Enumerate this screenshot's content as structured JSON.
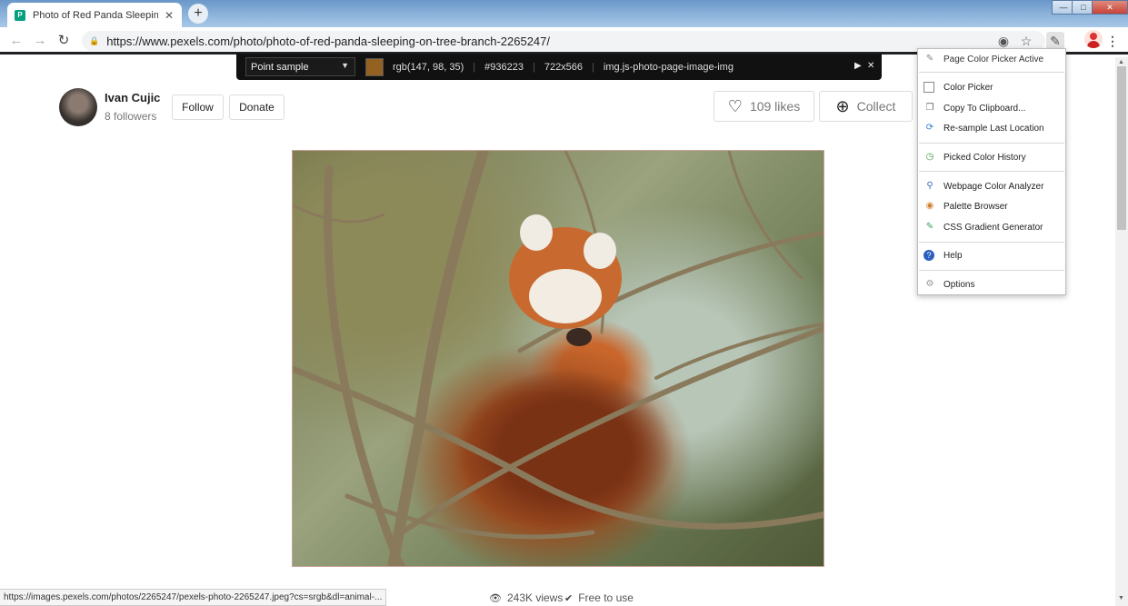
{
  "browser": {
    "tab_title": "Photo of Red Panda Sleeping on",
    "tab_close": "✕",
    "new_tab": "+",
    "url": "https://www.pexels.com/photo/photo-of-red-panda-sleeping-on-tree-branch-2265247/",
    "status_url": "https://images.pexels.com/photos/2265247/pexels-photo-2265247.jpeg?cs=srgb&dl=animal-..."
  },
  "author": {
    "name": "Ivan Cujic",
    "followers": "8 followers",
    "follow_label": "Follow",
    "donate_label": "Donate"
  },
  "actions": {
    "likes_label": "109 likes",
    "collect_label": "Collect"
  },
  "stats": {
    "views": "243K views",
    "license": "Free to use"
  },
  "color_picker_bar": {
    "mode": "Point sample",
    "swatch_color": "#936223",
    "rgb": "rgb(147, 98, 35)",
    "hex": "#936223",
    "size": "722x566",
    "selector": "img.js-photo-page-image-img"
  },
  "menu": {
    "header": "Page Color Picker Active",
    "items": [
      {
        "label": "Color Picker",
        "icon": "square-icon"
      },
      {
        "label": "Copy To Clipboard...",
        "icon": "copy-icon"
      },
      {
        "label": "Re-sample Last Location",
        "icon": "resample-icon"
      },
      {
        "label": "Picked Color History",
        "icon": "history-icon"
      },
      {
        "label": "Webpage Color Analyzer",
        "icon": "magnifier-icon"
      },
      {
        "label": "Palette Browser",
        "icon": "palette-icon"
      },
      {
        "label": "CSS Gradient Generator",
        "icon": "gradient-icon"
      },
      {
        "label": "Help",
        "icon": "help-icon"
      },
      {
        "label": "Options",
        "icon": "gear-icon"
      }
    ]
  }
}
